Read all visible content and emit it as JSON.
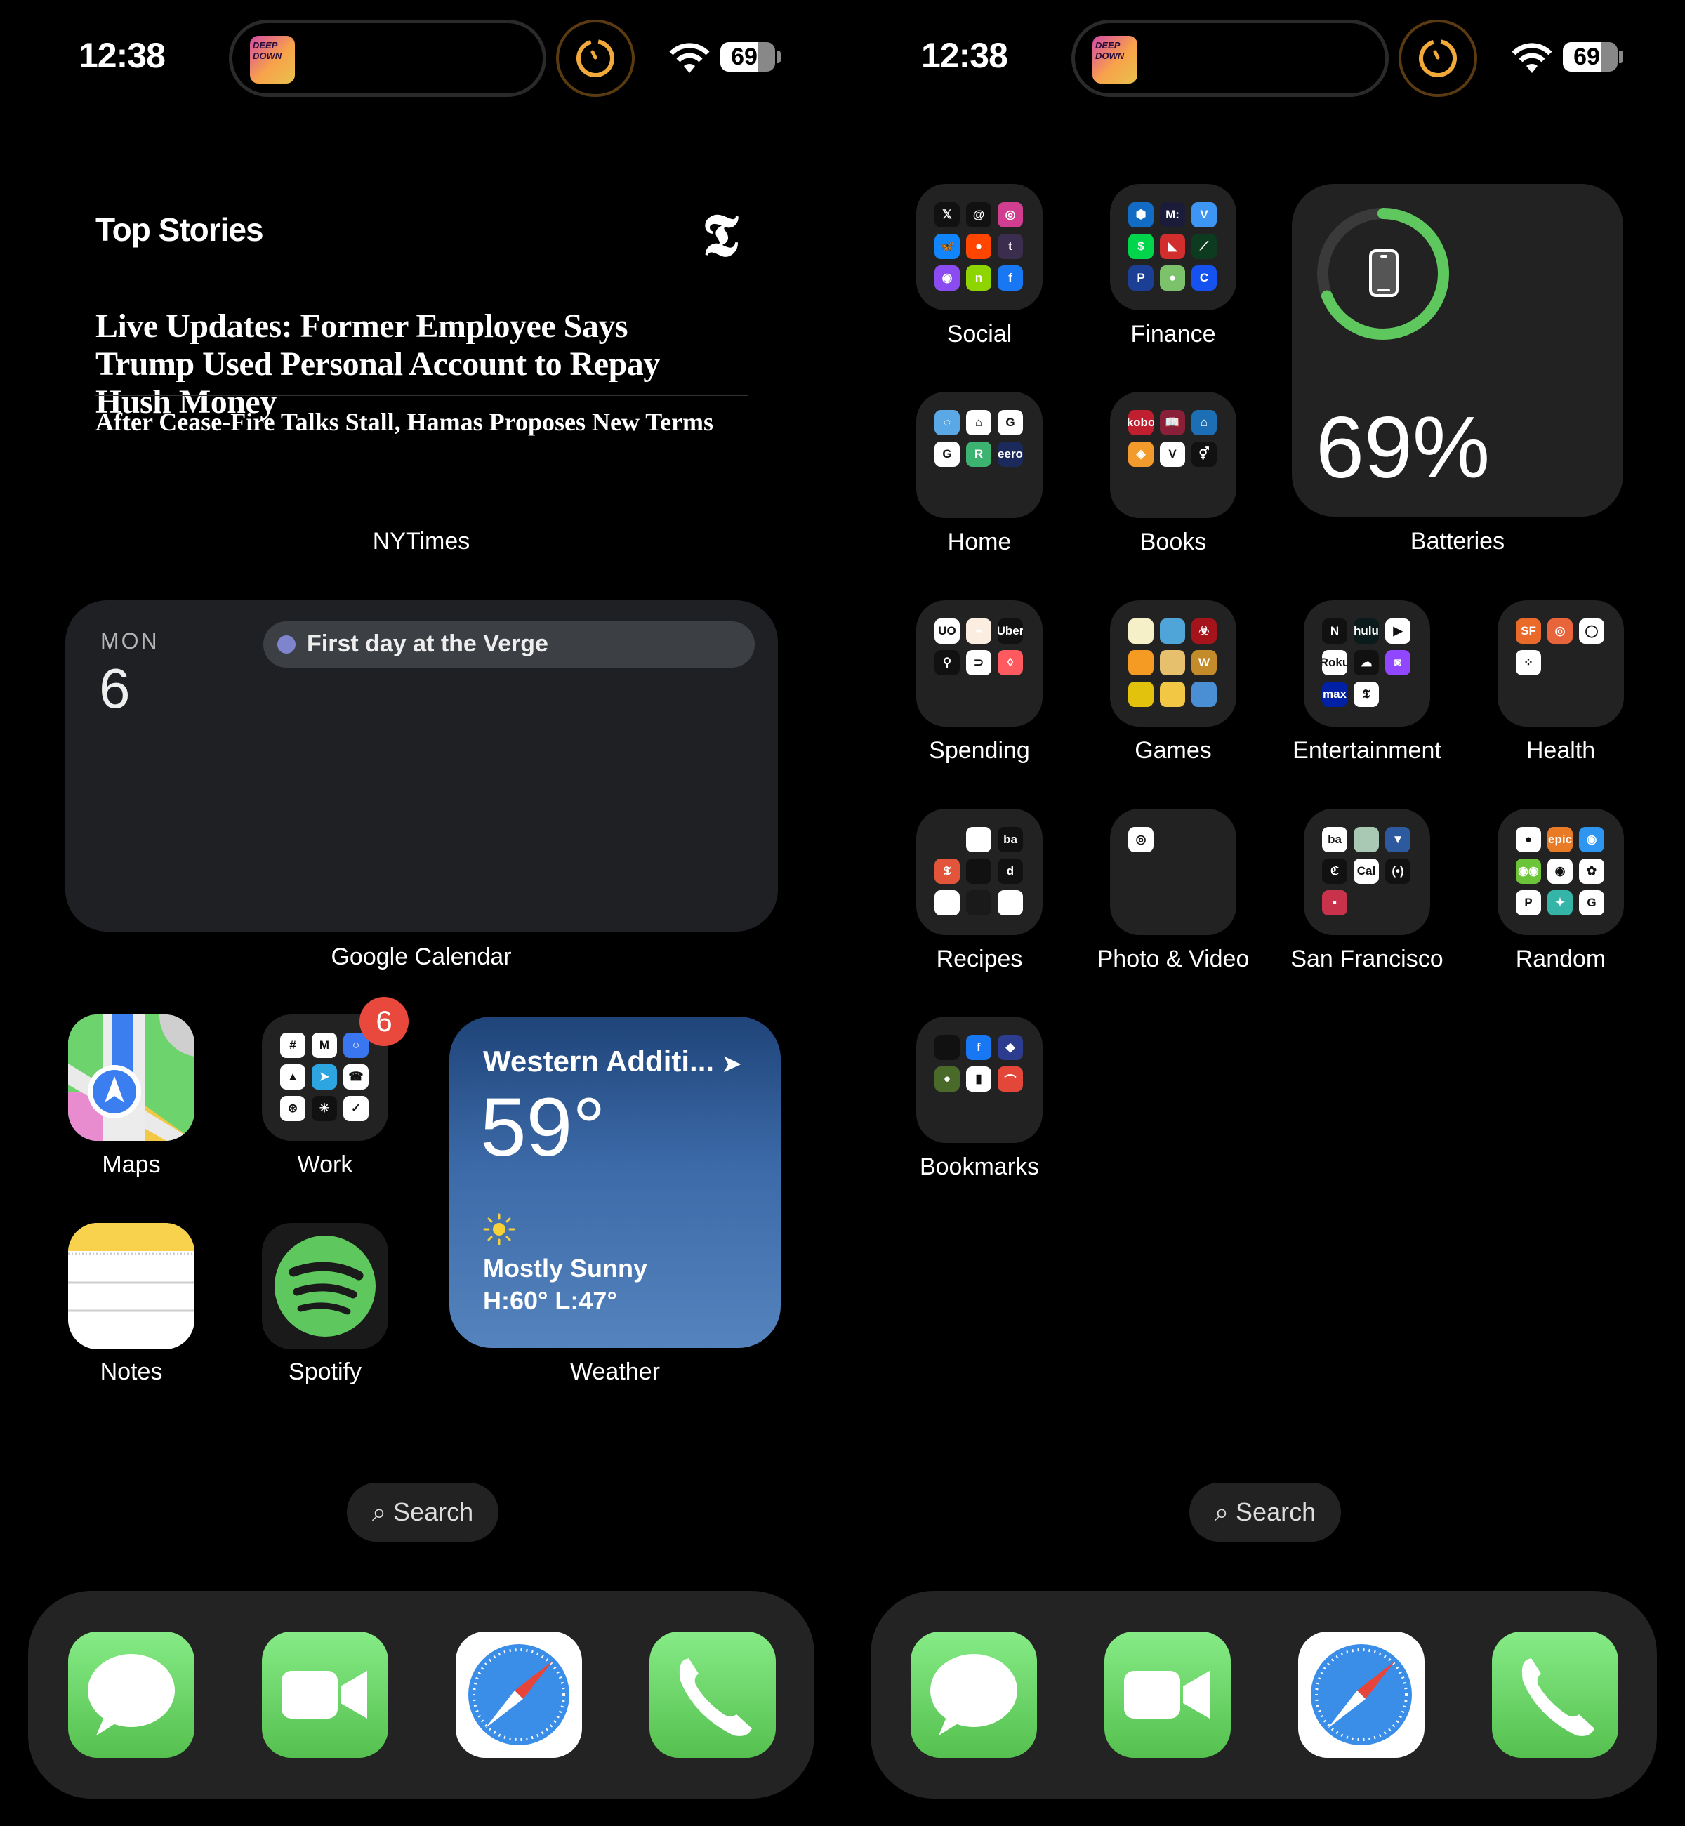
{
  "status_bar": {
    "time": "12:38",
    "battery_level": "69",
    "battery_fraction": 0.69,
    "now_playing_art_text": "DEEP DOWN",
    "timer_icon": "timer-icon",
    "wifi_icon": "wifi-icon"
  },
  "page1": {
    "nyt_widget": {
      "title": "Top Stories",
      "logo": "𝕿",
      "headline": "Live Updates: Former Employee Says Trump Used Personal Account to Repay Hush Money",
      "subheadline": "After Cease-Fire Talks Stall, Hamas Proposes New Terms",
      "label": "NYTimes"
    },
    "calendar_widget": {
      "day_of_week": "MON",
      "day": "6",
      "event": "First day at the Verge",
      "event_color": "#7f85cd",
      "label": "Google Calendar"
    },
    "apps": {
      "maps": "Maps",
      "work": "Work",
      "work_badge": "6",
      "notes": "Notes",
      "spotify": "Spotify"
    },
    "weather_widget": {
      "location": "Western Additi...",
      "temperature": "59°",
      "condition": "Mostly Sunny",
      "high_low": "H:60° L:47°",
      "label": "Weather"
    },
    "search_label": "Search"
  },
  "page2": {
    "folders": [
      {
        "label": "Social",
        "apps": [
          "X",
          "Threads",
          "Instagram",
          "Bluesky",
          "Reddit",
          "Tumblr",
          "Messenger",
          "Nextdoor",
          "Facebook"
        ]
      },
      {
        "label": "Finance",
        "apps": [
          "Chase",
          "Mint",
          "Venmo",
          "Cash App",
          "Capital One",
          "Robinhood",
          "PayPal",
          "Acorns",
          "Coinbase"
        ]
      },
      {
        "label": "Home",
        "apps": [
          "Alarm",
          "Google Home",
          "G",
          "G",
          "Rover",
          "eero"
        ]
      },
      {
        "label": "Books",
        "apps": [
          "Kobo",
          "Libby",
          "Kindle",
          "Audible",
          "V",
          "Symbol"
        ]
      },
      {
        "label": "Spending",
        "apps": [
          "UO",
          "Instacart",
          "Uber",
          "Postmates",
          "DoorDash",
          "Airbnb"
        ]
      },
      {
        "label": "Games",
        "apps": [
          "Doodle Jump",
          "Game",
          "Plague Inc",
          "Candy Crush",
          "Game",
          "Words",
          "Among Us",
          "Game",
          "Fallout"
        ]
      },
      {
        "label": "Entertainment",
        "apps": [
          "Netflix",
          "Hulu",
          "YouTube",
          "Roku",
          "SoundCloud",
          "Twitch",
          "Max",
          "NYT"
        ]
      },
      {
        "label": "Health",
        "apps": [
          "Fitness SF",
          "Strava",
          "Sense",
          "Dots"
        ]
      },
      {
        "label": "Recipes",
        "apps": [
          "App",
          "App",
          "ba",
          "NYT Cooking",
          "App",
          "d",
          "App",
          "Cup",
          "App"
        ]
      },
      {
        "label": "Photo & Video",
        "apps": [
          "VSCO"
        ]
      },
      {
        "label": "San Francisco",
        "apps": [
          "BART",
          "SF",
          "Muni",
          "Chronicle",
          "Caltrain",
          "Signal",
          "Muni"
        ]
      },
      {
        "label": "Random",
        "apps": [
          "App",
          "Epic",
          "App",
          "Duolingo",
          "Google Maps",
          "Google Photos",
          "PayPal",
          "App",
          "Translate"
        ]
      },
      {
        "label": "Bookmarks",
        "apps": [
          "App",
          "Facebook",
          "App",
          "App",
          "App",
          "Bridge"
        ]
      }
    ],
    "batteries_widget": {
      "percent_text": "69%",
      "level": 0.69,
      "label": "Batteries"
    },
    "search_label": "Search"
  },
  "dock": [
    {
      "name": "Messages",
      "icon": "messages-icon"
    },
    {
      "name": "FaceTime",
      "icon": "facetime-icon"
    },
    {
      "name": "Safari",
      "icon": "safari-icon"
    },
    {
      "name": "Phone",
      "icon": "phone-icon"
    }
  ],
  "colors": {
    "ring_green": "#5ec85e",
    "badge_red": "#e9493c",
    "weather_top": "#1f4479",
    "weather_bottom": "#5583bd"
  }
}
